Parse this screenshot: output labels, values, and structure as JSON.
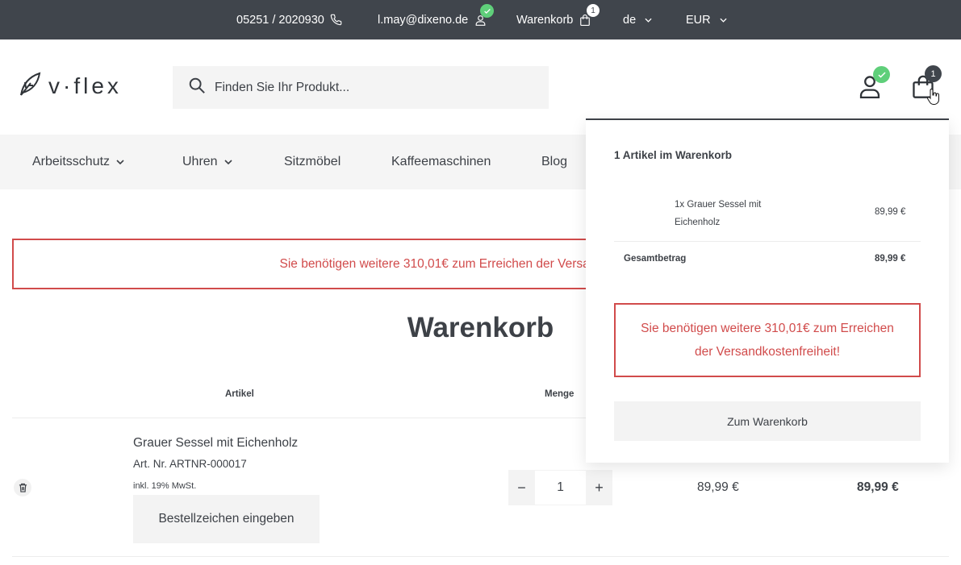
{
  "topbar": {
    "phone": "05251 / 2020930",
    "email": "l.may@dixeno.de",
    "cart_label": "Warenkorb",
    "cart_count": "1",
    "language": "de",
    "currency": "EUR"
  },
  "header": {
    "logo_text": "v·flex",
    "search_placeholder": "Finden Sie Ihr Produkt...",
    "cart_count": "1"
  },
  "nav": {
    "items": [
      {
        "label": "Arbeitsschutz",
        "has_dropdown": true
      },
      {
        "label": "Uhren",
        "has_dropdown": true
      },
      {
        "label": "Sitzmöbel",
        "has_dropdown": false
      },
      {
        "label": "Kaffeemaschinen",
        "has_dropdown": false
      },
      {
        "label": "Blog",
        "has_dropdown": false
      }
    ]
  },
  "notice": "Sie benötigen weitere 310,01€ zum Erreichen der Versandkostenfreiheit!",
  "cart": {
    "title": "Warenkorb",
    "columns": {
      "article": "Artikel",
      "quantity": "Menge"
    },
    "item": {
      "name": "Grauer Sessel mit Eichenholz",
      "sku": "Art. Nr. ARTNR-000017",
      "vat": "inkl. 19% MwSt.",
      "order_button": "Bestellzeichen eingeben",
      "quantity": "1",
      "minus": "−",
      "plus": "+",
      "unit_price": "89,99 €",
      "total_price": "89,99 €"
    }
  },
  "mini_cart": {
    "title": "1 Artikel im Warenkorb",
    "item_name": "1x Grauer Sessel mit Eichenholz",
    "item_price": "89,99 €",
    "total_label": "Gesamtbetrag",
    "total_value": "89,99 €",
    "notice": "Sie benötigen weitere 310,01€ zum Erreichen der Versandkostenfreiheit!",
    "button": "Zum Warenkorb"
  },
  "colors": {
    "topbar_bg": "#40454c",
    "text": "#3d4147",
    "alert_red": "#d14b4b",
    "badge_green": "#5fcf7a",
    "surface_grey": "#f4f4f4"
  },
  "icons": {
    "phone": "phone-icon",
    "account": "user-icon",
    "cart": "shopping-bag-icon",
    "search": "search-icon",
    "delete": "trash-icon",
    "check": "check-icon",
    "chevron": "chevron-down-icon"
  }
}
